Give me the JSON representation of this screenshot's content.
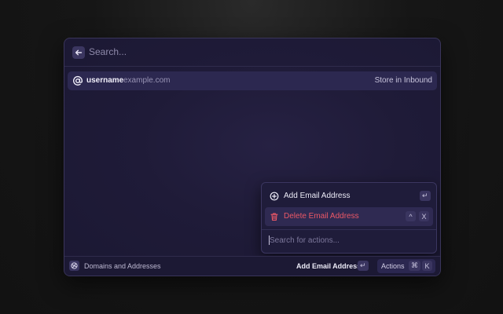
{
  "search": {
    "placeholder": "Search..."
  },
  "list": {
    "items": [
      {
        "name": "username",
        "domain": "example.com",
        "accessory": "Store in Inbound"
      }
    ]
  },
  "actions_panel": {
    "items": [
      {
        "label": "Add Email Address",
        "icon": "plus-circle-icon",
        "shortcut": [
          "↵"
        ]
      },
      {
        "label": "Delete Email Address",
        "icon": "trash-icon",
        "shortcut": [
          "^",
          "X"
        ]
      }
    ],
    "search_placeholder": "Search for actions..."
  },
  "footer": {
    "title": "Domains and Addresses",
    "primary_action": "Add Email Address",
    "primary_shortcut": "↵",
    "actions_label": "Actions",
    "actions_shortcut": [
      "⌘",
      "K"
    ]
  },
  "colors": {
    "background": "#161616",
    "window": "#1f1b38",
    "selected_row": "#2c2850",
    "destructive": "#ec5866",
    "muted_text": "#8e89aa"
  }
}
